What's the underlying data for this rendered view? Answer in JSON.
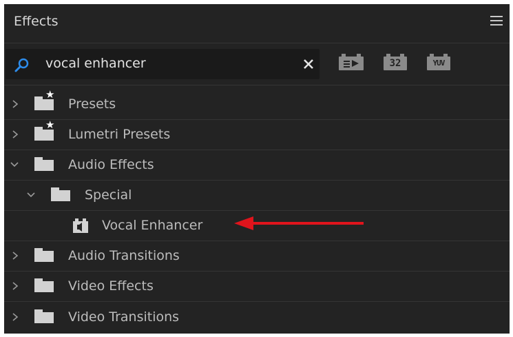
{
  "panel": {
    "title": "Effects"
  },
  "search": {
    "query": "vocal enhancer"
  },
  "filters": {
    "badge_32": "32",
    "badge_yuv": "YUV"
  },
  "tree": {
    "items": [
      {
        "label": "Presets"
      },
      {
        "label": "Lumetri Presets"
      },
      {
        "label": "Audio Effects"
      },
      {
        "label": "Special"
      },
      {
        "label": "Vocal Enhancer"
      },
      {
        "label": "Audio Transitions"
      },
      {
        "label": "Video Effects"
      },
      {
        "label": "Video Transitions"
      }
    ]
  },
  "colors": {
    "arrow": "#e0141c",
    "panel_bg": "#232323"
  }
}
